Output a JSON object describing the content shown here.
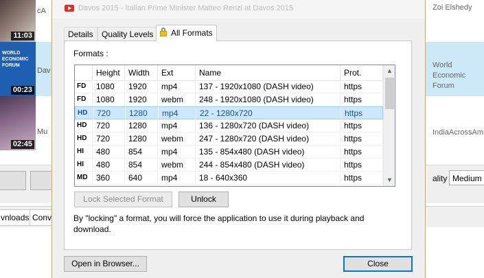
{
  "background": {
    "videos": [
      {
        "duration": "11:03",
        "title": "cA",
        "logo_lines": []
      },
      {
        "duration": "00:23",
        "title": "Dav",
        "logo_lines": [
          "WORLD",
          "ECONOMIC",
          "FORUM"
        ],
        "right_text": "World Economic Forum"
      },
      {
        "duration": "02:45",
        "title": "Mu",
        "logo_lines": [],
        "right_text": "IndiaAcrossAmr"
      }
    ],
    "top_right_text": "Zoi Elshedy",
    "quality_label": "ality :",
    "quality_value": "Medium",
    "bottom_tabs": [
      "vnloads",
      "Conv"
    ]
  },
  "dialog": {
    "title": "Davos 2015 - Italian Prime Minister Matteo Renzi at Davos 2015",
    "tabs": [
      {
        "label": "Details",
        "active": false
      },
      {
        "label": "Quality Levels",
        "active": false
      },
      {
        "label": "All Formats",
        "active": true,
        "icon": "lock-icon"
      }
    ],
    "formats_label": "Formats :",
    "columns": [
      "Height",
      "Width",
      "Ext",
      "Name",
      "Prot."
    ],
    "rows": [
      {
        "tag": "FD",
        "height": "1080",
        "width": "1920",
        "ext": "mp4",
        "name": "137 - 1920x1080 (DASH video)",
        "prot": "https",
        "selected": false
      },
      {
        "tag": "FD",
        "height": "1080",
        "width": "1920",
        "ext": "webm",
        "name": "248 - 1920x1080 (DASH video)",
        "prot": "https",
        "selected": false
      },
      {
        "tag": "HD",
        "height": "720",
        "width": "1280",
        "ext": "mp4",
        "name": "22 - 1280x720",
        "prot": "https",
        "selected": true
      },
      {
        "tag": "HD",
        "height": "720",
        "width": "1280",
        "ext": "mp4",
        "name": "136 - 1280x720 (DASH video)",
        "prot": "https",
        "selected": false
      },
      {
        "tag": "HD",
        "height": "720",
        "width": "1280",
        "ext": "webm",
        "name": "247 - 1280x720 (DASH video)",
        "prot": "https",
        "selected": false
      },
      {
        "tag": "HI",
        "height": "480",
        "width": "854",
        "ext": "mp4",
        "name": "135 - 854x480 (DASH video)",
        "prot": "https",
        "selected": false
      },
      {
        "tag": "HI",
        "height": "480",
        "width": "854",
        "ext": "webm",
        "name": "244 - 854x480 (DASH video)",
        "prot": "https",
        "selected": false
      },
      {
        "tag": "MD",
        "height": "360",
        "width": "640",
        "ext": "mp4",
        "name": "18 - 640x360",
        "prot": "https",
        "selected": false
      }
    ],
    "lock_button": "Lock Selected Format",
    "unlock_button": "Unlock",
    "info_text": "By \"locking\" a format, you will force the application to use it during playback and download.",
    "open_browser_button": "Open in Browser...",
    "close_button": "Close"
  },
  "colors": {
    "selection": "#cce8ff",
    "accent_border": "#e2a53e",
    "youtube_red": "#e52d27"
  }
}
